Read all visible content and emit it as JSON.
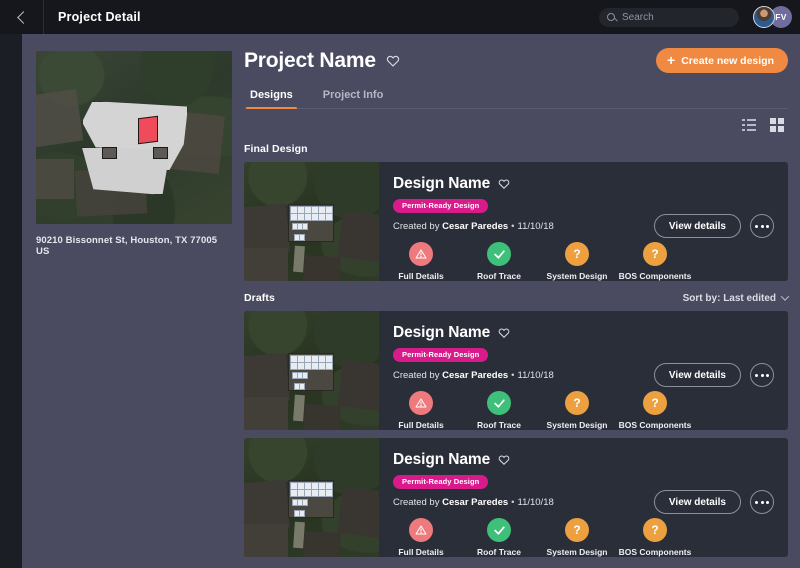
{
  "topbar": {
    "back_label": "Back",
    "title": "Project Detail",
    "search_placeholder": "Search",
    "search_value": "",
    "avatar_initials": "FV"
  },
  "property": {
    "address": "90210 Bissonnet St, Houston, TX 77005 US"
  },
  "header": {
    "project_name": "Project Name",
    "create_button": "Create new design",
    "create_button_icon": "plus-icon",
    "favorite_icon": "heart-outline-icon",
    "accent_color": "#f08a42"
  },
  "tabs": [
    {
      "label": "Designs",
      "active": true
    },
    {
      "label": "Project Info",
      "active": false
    }
  ],
  "view_toggle": {
    "list_icon": "list-view-icon",
    "grid_icon": "grid-view-icon",
    "active": "grid"
  },
  "sections": [
    {
      "title": "Final Design",
      "sort_label": "",
      "show_sort": false
    },
    {
      "title": "Drafts",
      "sort_label": "Sort by: Last edited",
      "show_sort": true
    }
  ],
  "status_colors": {
    "warning": "#ee7a7e",
    "complete": "#3fc07a",
    "unknown": "#eda040",
    "badge": "#d91a8a"
  },
  "design_card": {
    "name": "Design Name",
    "badge": "Permit-Ready Design",
    "created_prefix": "Created by",
    "author": "Cesar Paredes",
    "separator": "•",
    "date": "11/10/18",
    "view_button": "View details",
    "more_button": "More options",
    "favorite_icon": "heart-outline-icon",
    "statuses": [
      {
        "label": "Full Details",
        "state": "warn",
        "glyph": "warning-triangle-icon"
      },
      {
        "label": "Roof Trace",
        "state": "ok",
        "glyph": "check-icon"
      },
      {
        "label": "System Design",
        "state": "unk",
        "glyph": "question-icon"
      },
      {
        "label": "BOS Components",
        "state": "unk",
        "glyph": "question-icon"
      }
    ]
  },
  "cards": [
    {
      "section": "Final Design",
      "index": 0
    },
    {
      "section": "Drafts",
      "index": 1
    },
    {
      "section": "Drafts",
      "index": 2
    }
  ]
}
